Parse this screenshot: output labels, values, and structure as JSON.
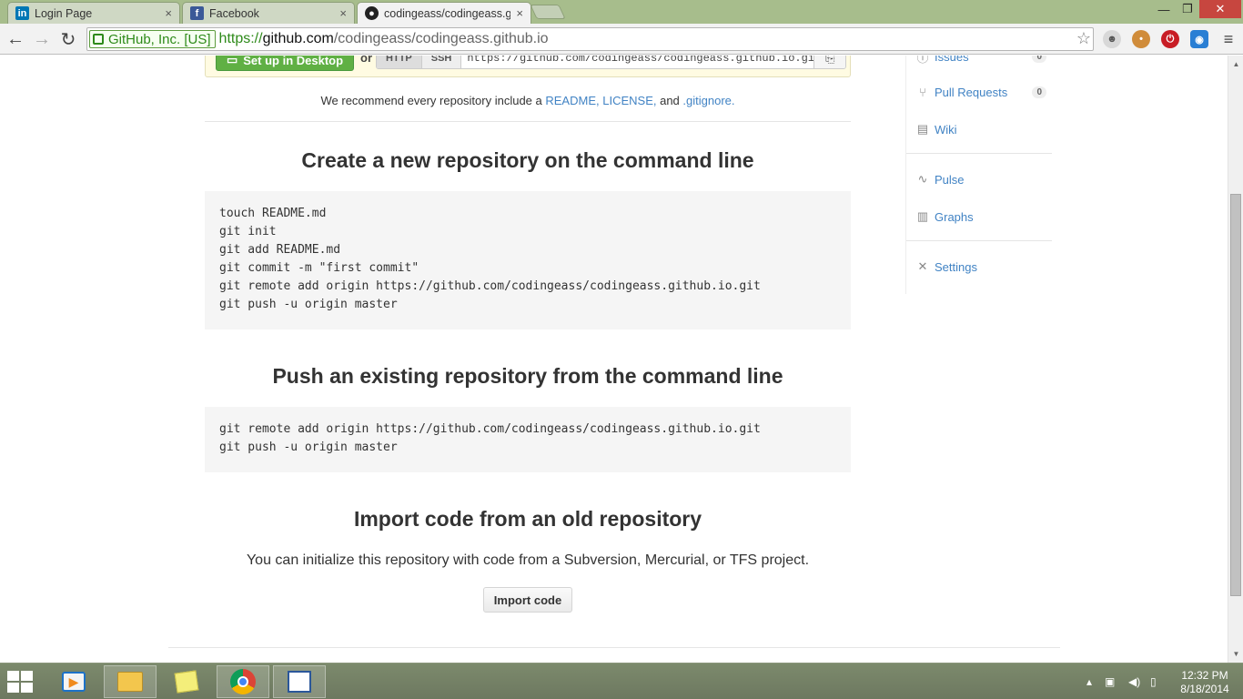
{
  "browser": {
    "tabs": [
      {
        "label": "Login Page",
        "favicon": "linkedin-icon",
        "color": "#0077b5",
        "active": false
      },
      {
        "label": "Facebook",
        "favicon": "facebook-icon",
        "color": "#3b5998",
        "active": false
      },
      {
        "label": "codingeass/codingeass.gi",
        "favicon": "github-icon",
        "color": "#222222",
        "active": true
      }
    ],
    "tab_close": "×",
    "window_controls": {
      "minimize": "—",
      "restore": "❐",
      "close": "✕"
    },
    "nav": {
      "back": "←",
      "forward": "→",
      "reload": "↻"
    },
    "omnibox": {
      "ev_label": "GitHub, Inc. [US]",
      "scheme": "https://",
      "host": "github.com",
      "path": "/codingeass/codingeass.github.io"
    },
    "star": "☆"
  },
  "page": {
    "setup": {
      "desktop_button": "Set up in Desktop",
      "or": "or",
      "protocols": [
        "HTTP",
        "SSH"
      ],
      "clone_url": "https://github.com/codingeass/codingeass.github.io.git",
      "clipboard": "⎘"
    },
    "recommend": {
      "prefix": "We recommend every repository include a ",
      "readme": "README,",
      "license": "LICENSE,",
      "and": " and ",
      "gitignore": ".gitignore."
    },
    "create_section": {
      "title": "Create a new repository on the command line",
      "code": "touch README.md\ngit init\ngit add README.md\ngit commit -m \"first commit\"\ngit remote add origin https://github.com/codingeass/codingeass.github.io.git\ngit push -u origin master"
    },
    "push_section": {
      "title": "Push an existing repository from the command line",
      "code": "git remote add origin https://github.com/codingeass/codingeass.github.io.git\ngit push -u origin master"
    },
    "import_section": {
      "title": "Import code from an old repository",
      "description": "You can initialize this repository with code from a Subversion, Mercurial, or TFS project.",
      "button": "Import code"
    },
    "sidebar": {
      "items": [
        {
          "label": "Issues",
          "icon": "issue-icon",
          "count": "0"
        },
        {
          "label": "Pull Requests",
          "icon": "pull-request-icon",
          "count": "0"
        },
        {
          "label": "Wiki",
          "icon": "wiki-icon"
        },
        {
          "label": "Pulse",
          "icon": "pulse-icon"
        },
        {
          "label": "Graphs",
          "icon": "graph-icon"
        },
        {
          "label": "Settings",
          "icon": "tools-icon"
        }
      ]
    }
  },
  "taskbar": {
    "apps": [
      "windows-media-icon",
      "file-explorer-icon",
      "sticky-notes-icon",
      "chrome-icon",
      "reader-icon"
    ],
    "clock": {
      "time": "12:32 PM",
      "date": "8/18/2014"
    }
  }
}
